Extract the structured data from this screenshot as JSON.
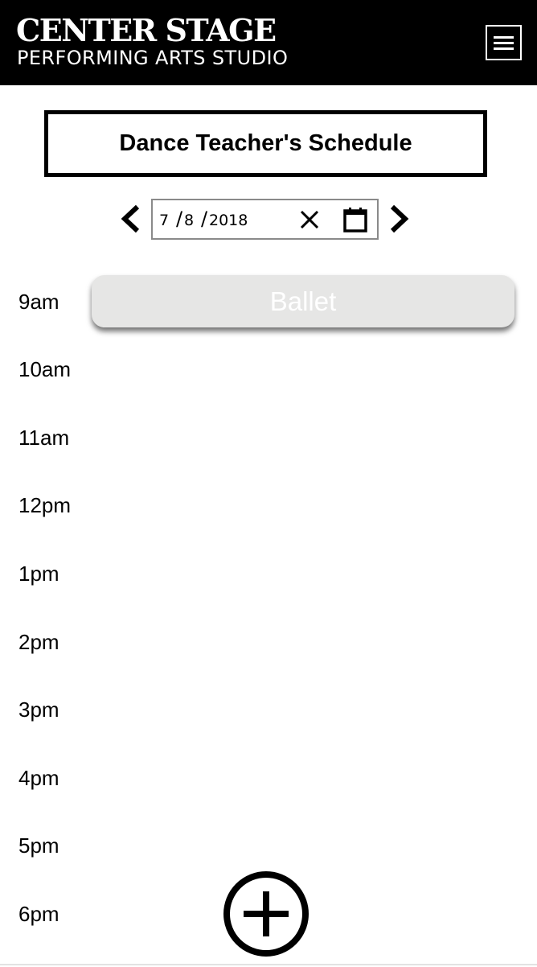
{
  "header": {
    "brand_title": "CENTER STAGE",
    "brand_subtitle": "PERFORMING ARTS STUDIO",
    "menu_icon": "hamburger-menu-icon",
    "background": "#000000",
    "foreground": "#ffffff"
  },
  "page": {
    "title": "Dance Teacher's Schedule"
  },
  "date_picker": {
    "month": "7",
    "day": "8",
    "year": "2018",
    "separator": "/",
    "prev_icon": "chevron-left-icon",
    "next_icon": "chevron-right-icon",
    "clear_icon": "close-icon",
    "calendar_icon": "calendar-icon"
  },
  "schedule": {
    "times": [
      "9am",
      "10am",
      "11am",
      "12pm",
      "1pm",
      "2pm",
      "3pm",
      "4pm",
      "5pm",
      "6pm"
    ],
    "events": [
      {
        "label": "Ballet",
        "time": "9am",
        "color": "#e6e6e5"
      }
    ]
  },
  "actions": {
    "add_icon": "add-circle-icon"
  }
}
